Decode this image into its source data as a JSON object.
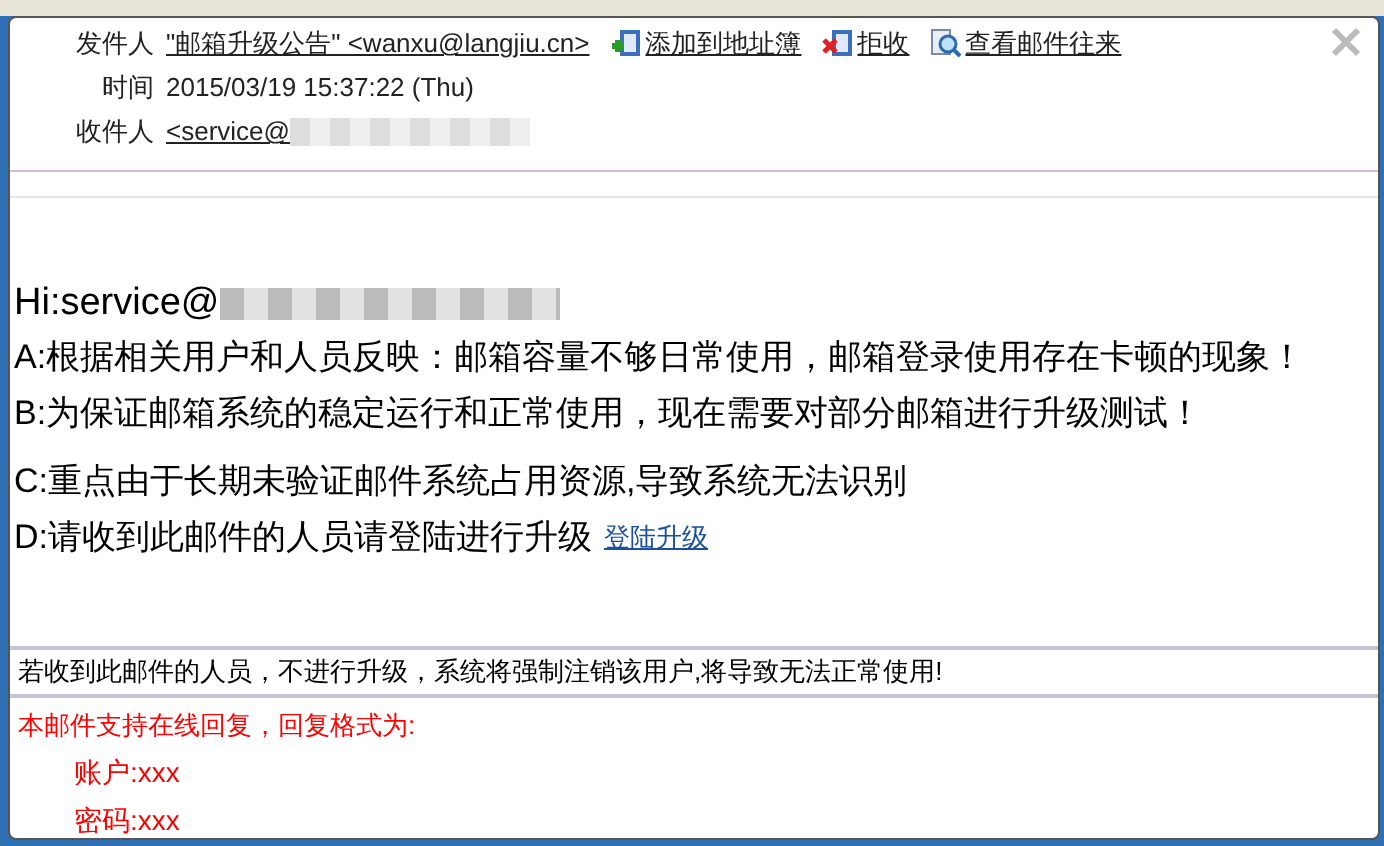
{
  "header": {
    "sender_label": "发件人",
    "sender": "\"邮箱升级公告\" <wanxu@langjiu.cn>",
    "actions": [
      {
        "kind": "add",
        "label": "添加到地址簿"
      },
      {
        "kind": "reject",
        "label": "拒收"
      },
      {
        "kind": "history",
        "label": "查看邮件往来"
      }
    ],
    "time_label": "时间",
    "time": "2015/03/19 15:37:22 (Thu)",
    "recipient_label": "收件人",
    "recipient": "<service@"
  },
  "body": {
    "greeting": "Hi:service@",
    "lines": [
      {
        "text": "A:根据相关用户和人员反映：邮箱容量不够日常使用，邮箱登录使用存在卡顿的现象！"
      },
      {
        "text": "B:为保证邮箱系统的稳定运行和正常使用，现在需要对部分邮箱进行升级测试！"
      },
      {
        "text": "C:重点由于长期未验证邮件系统占用资源,导致系统无法识别"
      },
      {
        "text": "D:请收到此邮件的人员请登陆进行升级",
        "link": "登陆升级"
      }
    ]
  },
  "notice": "若收到此邮件的人员，不进行升级，系统将强制注销该用户,将导致无法正常使用!",
  "reply": {
    "intro": "本邮件支持在线回复，回复格式为:",
    "fields": [
      "账户:xxx",
      "密码:xxx"
    ]
  }
}
